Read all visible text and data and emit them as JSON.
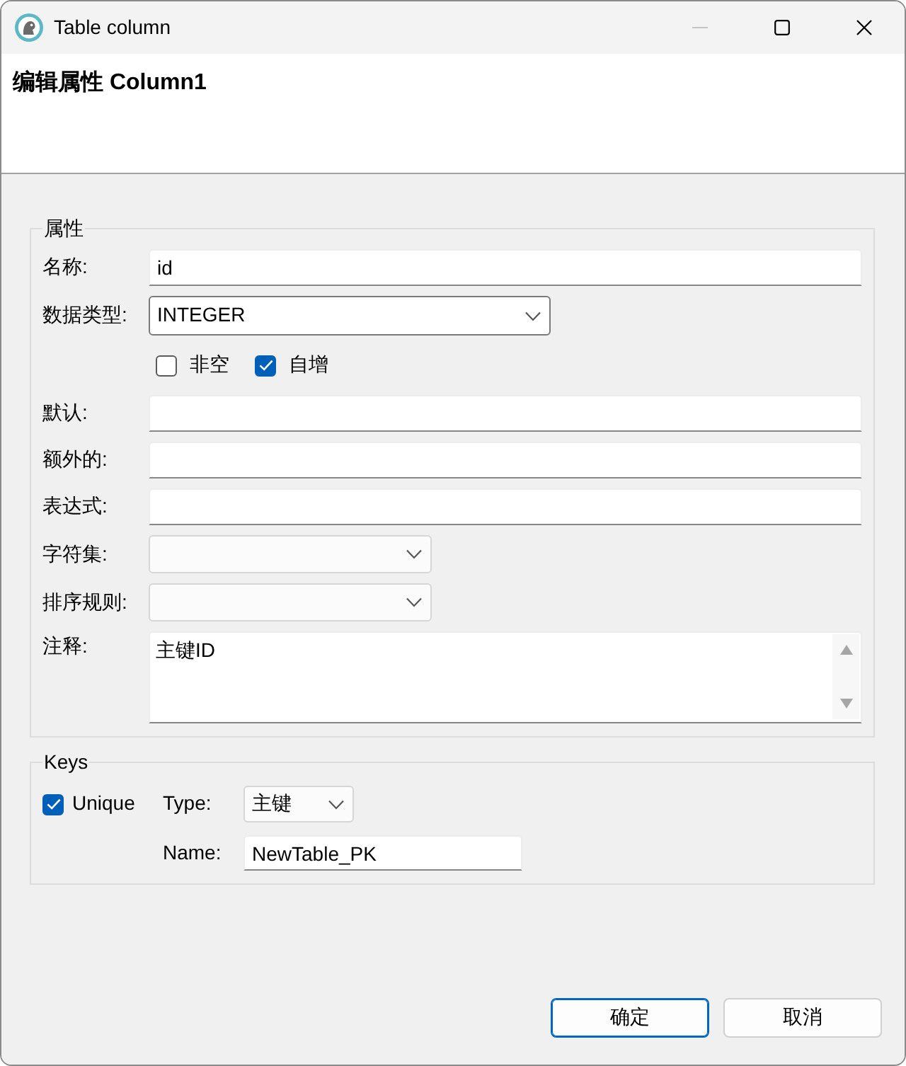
{
  "window": {
    "title": "Table column",
    "minimize_disabled": true
  },
  "header": {
    "title": "编辑属性 Column1"
  },
  "properties": {
    "legend": "属性",
    "fields": [
      {
        "kind": "text",
        "label": "名称:",
        "value": "id"
      },
      {
        "kind": "combo",
        "label": "数据类型:",
        "value": "INTEGER"
      },
      {
        "kind": "checks",
        "items": [
          {
            "label": "非空",
            "checked": false
          },
          {
            "label": "自增",
            "checked": true
          }
        ]
      },
      {
        "kind": "text",
        "label": "默认:"
      },
      {
        "kind": "text",
        "label": "额外的:"
      },
      {
        "kind": "text",
        "label": "表达式:"
      },
      {
        "kind": "select",
        "label": "字符集:"
      },
      {
        "kind": "select",
        "label": "排序规则:"
      },
      {
        "kind": "textarea",
        "label": "注释:",
        "value": "主键ID"
      }
    ]
  },
  "keys": {
    "legend": "Keys",
    "unique": {
      "label": "Unique",
      "checked": true
    },
    "type": {
      "label": "Type:",
      "value": "主键"
    },
    "name": {
      "label": "Name:",
      "value": "NewTable_PK"
    }
  },
  "buttons": [
    {
      "label": "确定",
      "default": true
    },
    {
      "label": "取消",
      "default": false
    }
  ]
}
